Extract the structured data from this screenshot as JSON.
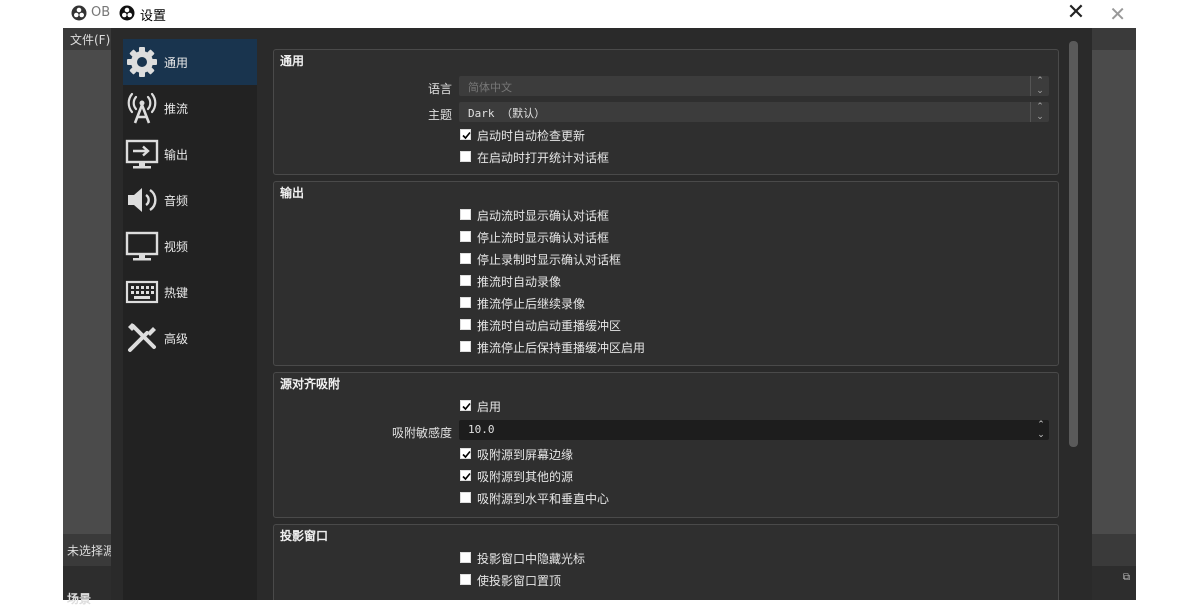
{
  "background_window": {
    "title": "OB",
    "menu_file": "文件(F)",
    "status_text": "未选择源",
    "dock_title": "场景"
  },
  "dialog": {
    "title": "设置",
    "close_glyph": "✕"
  },
  "sidebar": {
    "items": [
      {
        "label": "通用",
        "icon": "gear-icon"
      },
      {
        "label": "推流",
        "icon": "broadcast-icon"
      },
      {
        "label": "输出",
        "icon": "output-icon"
      },
      {
        "label": "音频",
        "icon": "speaker-icon"
      },
      {
        "label": "视频",
        "icon": "monitor-icon"
      },
      {
        "label": "热键",
        "icon": "keyboard-icon"
      },
      {
        "label": "高级",
        "icon": "tools-icon"
      }
    ],
    "active_index": 0
  },
  "general": {
    "title": "通用",
    "language_label": "语言",
    "language_value": "简体中文",
    "theme_label": "主题",
    "theme_value": "Dark （默认）",
    "check_updates": {
      "label": "启动时自动检查更新",
      "checked": true
    },
    "open_stats": {
      "label": "在启动时打开统计对话框",
      "checked": false
    }
  },
  "output": {
    "title": "输出",
    "options": [
      {
        "label": "启动流时显示确认对话框",
        "checked": false
      },
      {
        "label": "停止流时显示确认对话框",
        "checked": false
      },
      {
        "label": "停止录制时显示确认对话框",
        "checked": false
      },
      {
        "label": "推流时自动录像",
        "checked": false
      },
      {
        "label": "推流停止后继续录像",
        "checked": false
      },
      {
        "label": "推流时自动启动重播缓冲区",
        "checked": false
      },
      {
        "label": "推流停止后保持重播缓冲区启用",
        "checked": false
      }
    ]
  },
  "snapping": {
    "title": "源对齐吸附",
    "enable": {
      "label": "启用",
      "checked": true
    },
    "sensitivity_label": "吸附敏感度",
    "sensitivity_value": "10.0",
    "options": [
      {
        "label": "吸附源到屏幕边缘",
        "checked": true
      },
      {
        "label": "吸附源到其他的源",
        "checked": true
      },
      {
        "label": "吸附源到水平和垂直中心",
        "checked": false
      }
    ]
  },
  "projectors": {
    "title": "投影窗口",
    "options": [
      {
        "label": "投影窗口中隐藏光标",
        "checked": false
      },
      {
        "label": "使投影窗口置顶",
        "checked": false
      }
    ]
  },
  "colors": {
    "sidebar_active": "#19344e",
    "dialog_bg": "#2a2a2a",
    "group_bg": "#2f2f2f"
  }
}
